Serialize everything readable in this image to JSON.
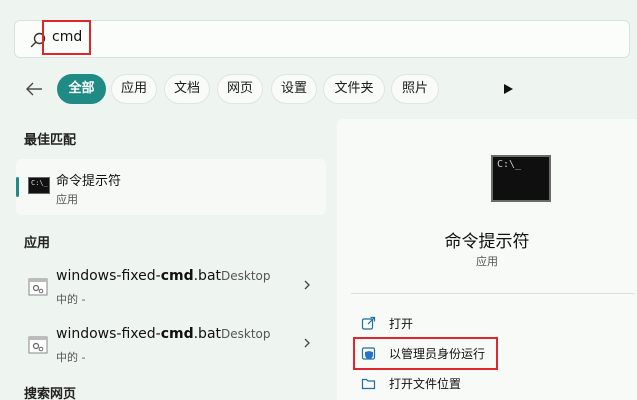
{
  "search": {
    "query": "cmd"
  },
  "filters": [
    "全部",
    "应用",
    "文档",
    "网页",
    "设置",
    "文件夹",
    "照片"
  ],
  "sections": {
    "best_match": "最佳匹配",
    "apps": "应用",
    "web": "搜索网页"
  },
  "best_match": {
    "title": "命令提示符",
    "subtitle": "应用"
  },
  "apps": [
    {
      "name_prefix": "windows-fixed-",
      "name_bold": "cmd",
      "name_ext": ".bat",
      "location": "Desktop",
      "subtitle": "中的 -"
    },
    {
      "name_prefix": "windows-fixed-",
      "name_bold": "cmd",
      "name_ext": ".bat",
      "location": "Desktop",
      "subtitle": "中的 -"
    }
  ],
  "detail": {
    "title": "命令提示符",
    "subtitle": "应用",
    "actions": [
      {
        "label": "打开",
        "icon": "open-external-icon"
      },
      {
        "label": "以管理员身份运行",
        "icon": "shield-admin-icon"
      },
      {
        "label": "打开文件位置",
        "icon": "folder-icon"
      }
    ]
  },
  "colors": {
    "accent": "#1f8b84",
    "highlight": "#e0262c"
  }
}
